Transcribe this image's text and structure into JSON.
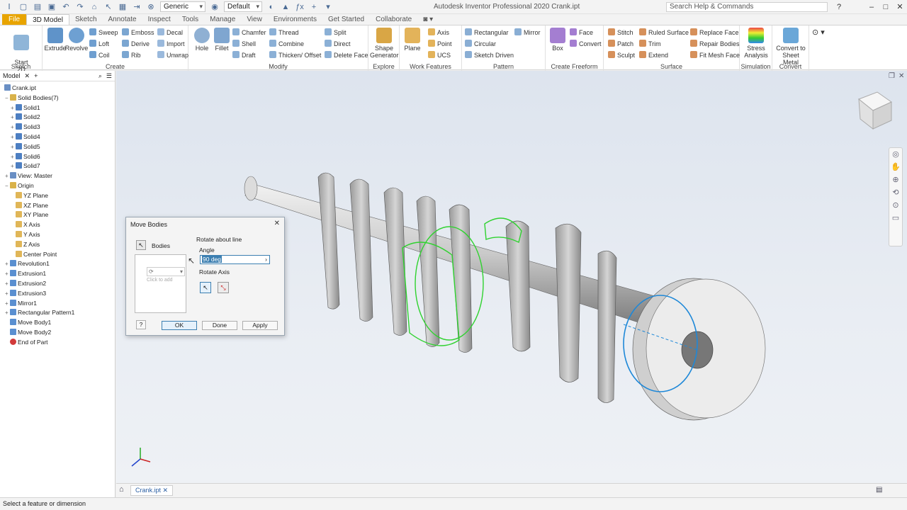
{
  "app": {
    "title": "Autodesk Inventor Professional 2020   Crank.ipt",
    "search_placeholder": "Search Help & Commands",
    "material_dropdown": "Generic",
    "appearance_dropdown": "Default"
  },
  "tabs": [
    "File",
    "3D Model",
    "Sketch",
    "Annotate",
    "Inspect",
    "Tools",
    "Manage",
    "View",
    "Environments",
    "Get Started",
    "Collaborate"
  ],
  "ribbon": {
    "sketch": {
      "label": "Sketch",
      "start": "Start\n2D Sketch"
    },
    "create": {
      "label": "Create",
      "extrude": "Extrude",
      "revolve": "Revolve",
      "sweep": "Sweep",
      "loft": "Loft",
      "coil": "Coil",
      "emboss": "Emboss",
      "derive": "Derive",
      "rib": "Rib",
      "decal": "Decal",
      "import": "Import",
      "unwrap": "Unwrap"
    },
    "modify": {
      "label": "Modify",
      "hole": "Hole",
      "fillet": "Fillet",
      "chamfer": "Chamfer",
      "shell": "Shell",
      "draft": "Draft",
      "thread": "Thread",
      "combine": "Combine",
      "thicken": "Thicken/ Offset",
      "split": "Split",
      "direct": "Direct",
      "delete_face": "Delete Face"
    },
    "explore": {
      "label": "Explore",
      "shape": "Shape\nGenerator"
    },
    "work": {
      "label": "Work Features",
      "plane": "Plane",
      "axis": "Axis",
      "point": "Point",
      "ucs": "UCS"
    },
    "pattern": {
      "label": "Pattern",
      "rect": "Rectangular",
      "circular": "Circular",
      "sketch_driven": "Sketch Driven",
      "mirror": "Mirror"
    },
    "freeform": {
      "label": "Create Freeform",
      "box": "Box",
      "face": "Face",
      "convert": "Convert"
    },
    "surface": {
      "label": "Surface",
      "stitch": "Stitch",
      "patch": "Patch",
      "sculpt": "Sculpt",
      "ruled": "Ruled Surface",
      "trim": "Trim",
      "extend": "Extend",
      "replace": "Replace Face",
      "repair": "Repair Bodies",
      "fitmesh": "Fit Mesh Face"
    },
    "simulation": {
      "label": "Simulation",
      "stress": "Stress\nAnalysis"
    },
    "convert": {
      "label": "Convert",
      "sheetmetal": "Convert to\nSheet Metal"
    }
  },
  "browser": {
    "tab": "Model",
    "items": [
      "Crank.ipt",
      "Solid Bodies(7)",
      "Solid1",
      "Solid2",
      "Solid3",
      "Solid4",
      "Solid5",
      "Solid6",
      "Solid7",
      "View: Master",
      "Origin",
      "YZ Plane",
      "XZ Plane",
      "XY Plane",
      "X Axis",
      "Y Axis",
      "Z Axis",
      "Center Point",
      "Revolution1",
      "Extrusion1",
      "Extrusion2",
      "Extrusion3",
      "Mirror1",
      "Rectangular Pattern1",
      "Move Body1",
      "Move Body2",
      "End of Part"
    ]
  },
  "dialog": {
    "title": "Move Bodies",
    "bodies_label": "Bodies",
    "mode": "Rotate about line",
    "angle_label": "Angle",
    "angle_value": "90 deg",
    "axis_label": "Rotate Axis",
    "click_to_add": "Click to add",
    "ok": "OK",
    "done": "Done",
    "apply": "Apply"
  },
  "doc_tab": "Crank.ipt",
  "status": "Select a feature or dimension",
  "colors": {
    "accent": "#e8a400",
    "selection": "#2fd22f",
    "highlight": "#1e88d8"
  }
}
